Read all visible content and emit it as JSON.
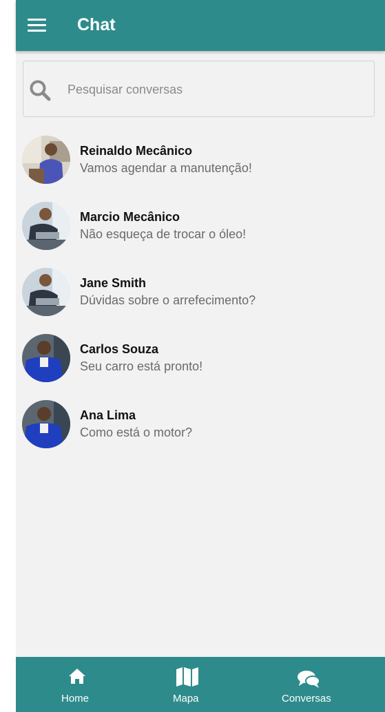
{
  "header": {
    "title": "Chat",
    "menu_icon": "hamburger-menu-icon"
  },
  "search": {
    "placeholder": "Pesquisar conversas",
    "icon": "search-icon"
  },
  "conversations": [
    {
      "name": "Reinaldo Mecânico",
      "message": "Vamos agendar a manutenção!"
    },
    {
      "name": "Marcio Mecânico",
      "message": "Não esqueça de trocar o óleo!"
    },
    {
      "name": "Jane Smith",
      "message": "Dúvidas sobre o arrefecimento?"
    },
    {
      "name": "Carlos Souza",
      "message": "Seu carro está pronto!"
    },
    {
      "name": "Ana Lima",
      "message": "Como está o motor?"
    }
  ],
  "bottom_nav": {
    "items": [
      {
        "label": "Home",
        "icon": "home-icon"
      },
      {
        "label": "Mapa",
        "icon": "map-icon"
      },
      {
        "label": "Conversas",
        "icon": "chat-bubbles-icon"
      }
    ]
  },
  "colors": {
    "primary": "#2e8b8b",
    "background": "#f2f2f2",
    "text_secondary": "#6a6a6a"
  }
}
